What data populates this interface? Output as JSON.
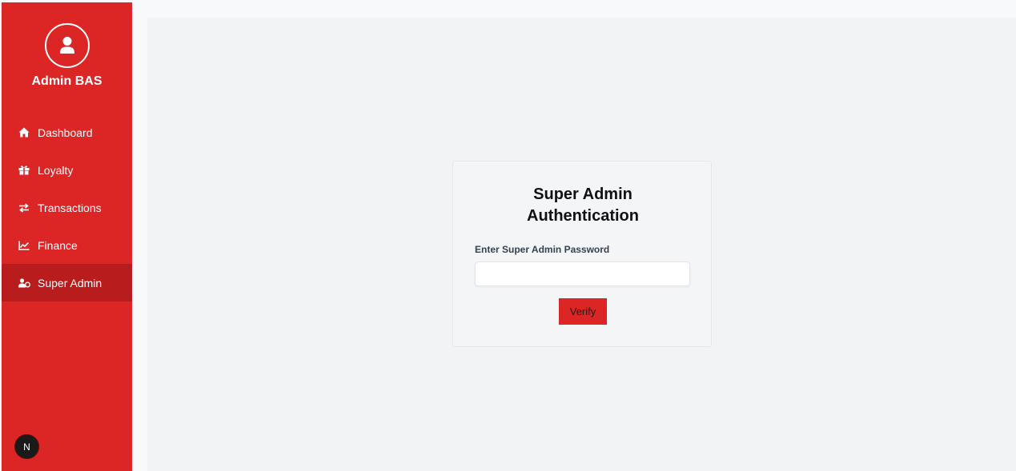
{
  "sidebar": {
    "brand": "Admin BAS",
    "avatar_icon": "user-circle-icon",
    "items": [
      {
        "label": "Dashboard",
        "icon": "home-icon",
        "active": false
      },
      {
        "label": "Loyalty",
        "icon": "gift-icon",
        "active": false
      },
      {
        "label": "Transactions",
        "icon": "exchange-icon",
        "active": false
      },
      {
        "label": "Finance",
        "icon": "chart-line-icon",
        "active": false
      },
      {
        "label": "Super Admin",
        "icon": "user-shield-icon",
        "active": true
      }
    ],
    "badge": "N"
  },
  "auth": {
    "title_line1": "Super Admin",
    "title_line2": "Authentication",
    "password_label": "Enter Super Admin Password",
    "password_value": "",
    "verify_label": "Verify"
  },
  "colors": {
    "sidebar_bg": "#dc2626",
    "active_item_bg": "#b91c1c",
    "main_bg": "#f2f3f5",
    "button_bg": "#dc2626"
  }
}
